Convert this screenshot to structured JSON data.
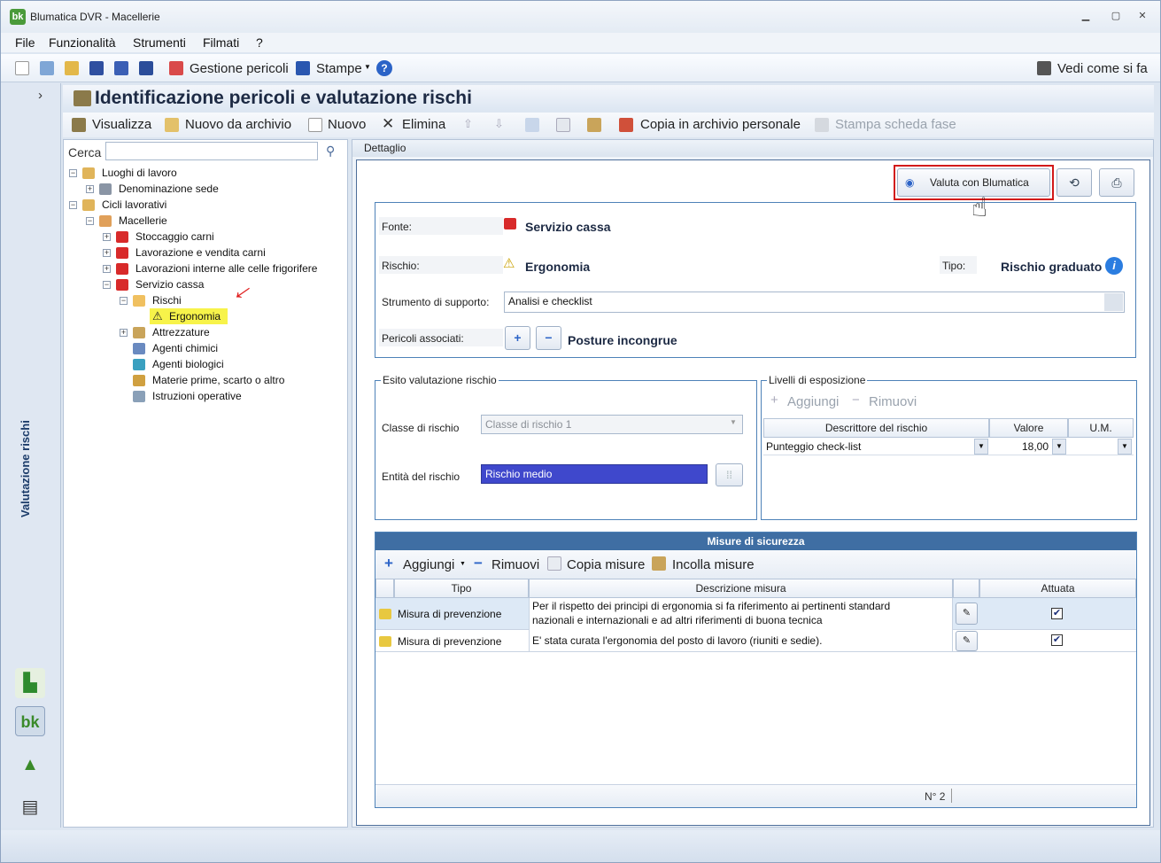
{
  "window": {
    "title": "Blumatica DVR - Macellerie",
    "logo": "bk"
  },
  "menu": [
    "File",
    "Funzionalità",
    "Strumenti",
    "Filmati",
    "?"
  ],
  "toolbar": {
    "gestione_pericoli": "Gestione pericoli",
    "stampe": "Stampe",
    "vedi_come": "Vedi come si fa"
  },
  "sidebar": {
    "label": "Valutazione rischi",
    "chevron": "›"
  },
  "header": {
    "title": "Identificazione pericoli e valutazione rischi"
  },
  "commands": {
    "visualizza": "Visualizza",
    "nuovo_archivio": "Nuovo da archivio",
    "nuovo": "Nuovo",
    "elimina": "Elimina",
    "copia_archivio": "Copia in archivio personale",
    "stampa_scheda": "Stampa scheda fase"
  },
  "search": {
    "label": "Cerca",
    "value": ""
  },
  "tree": {
    "luoghi": "Luoghi di lavoro",
    "denominazione": "Denominazione sede",
    "cicli": "Cicli lavorativi",
    "macellerie": "Macellerie",
    "stoccaggio": "Stoccaggio carni",
    "lavorazione": "Lavorazione e vendita carni",
    "interne": "Lavorazioni interne alle celle frigorifere",
    "servizio": "Servizio cassa",
    "rischi": "Rischi",
    "ergonomia": "Ergonomia",
    "attrezzature": "Attrezzature",
    "chimici": "Agenti chimici",
    "biologici": "Agenti biologici",
    "materie": "Materie prime, scarto o altro",
    "istruzioni": "Istruzioni operative"
  },
  "detail": {
    "tab": "Dettaglio",
    "valuta_button": "Valuta con Blumatica",
    "fonte_label": "Fonte:",
    "fonte_value": "Servizio cassa",
    "rischio_label": "Rischio:",
    "rischio_value": "Ergonomia",
    "tipo_label": "Tipo:",
    "tipo_value": "Rischio graduato",
    "strumento_label": "Strumento di supporto:",
    "strumento_value": "Analisi e checklist",
    "pericoli_label": "Pericoli associati:",
    "pericoli_value": "Posture incongrue"
  },
  "esito": {
    "title": "Esito valutazione rischio",
    "classe_label": "Classe di rischio",
    "classe_value": "Classe di rischio 1",
    "entita_label": "Entità del rischio",
    "entita_value": "Rischio medio",
    "entita_color": "#3f48cc"
  },
  "livelli": {
    "title": "Livelli di esposizione",
    "aggiungi": "Aggiungi",
    "rimuovi": "Rimuovi",
    "headers": [
      "Descrittore del rischio",
      "Valore",
      "U.M."
    ],
    "row": {
      "descrittore": "Punteggio check-list",
      "valore": "18,00",
      "um": ""
    }
  },
  "misure": {
    "title": "Misure di sicurezza",
    "aggiungi": "Aggiungi",
    "rimuovi": "Rimuovi",
    "copia": "Copia misure",
    "incolla": "Incolla misure",
    "headers": [
      "Tipo",
      "Descrizione misura",
      "Attuata"
    ],
    "rows": [
      {
        "tipo": "Misura di prevenzione",
        "descr1": "Per il rispetto dei principi di ergonomia si fa riferimento ai pertinenti standard",
        "descr2": "nazionali e internazionali e ad altri riferimenti di buona tecnica",
        "attuata": "✔"
      },
      {
        "tipo": "Misura di prevenzione",
        "descr1": "E' stata curata l'ergonomia del posto di lavoro (riuniti e sedie).",
        "descr2": "",
        "attuata": "✔"
      }
    ],
    "count": "N° 2"
  }
}
